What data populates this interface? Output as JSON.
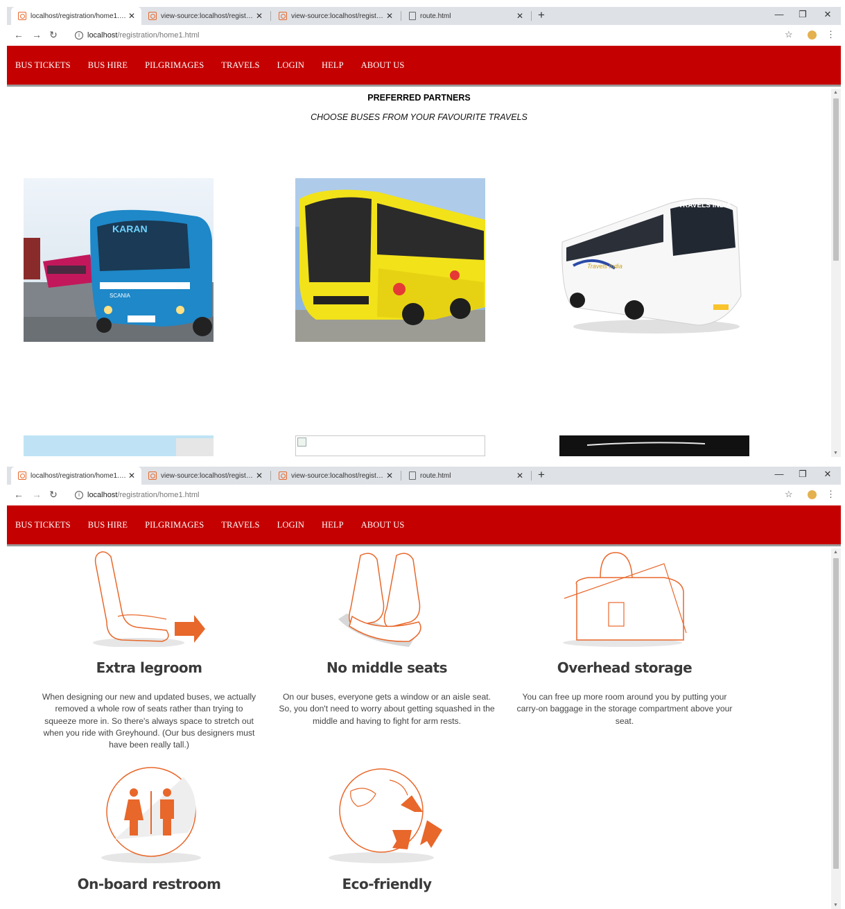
{
  "browser": {
    "tabs": [
      {
        "title": "localhost/registration/home1.htm",
        "icon": "page-icon"
      },
      {
        "title": "view-source:localhost/registration",
        "icon": "page-icon"
      },
      {
        "title": "view-source:localhost/registration",
        "icon": "page-icon"
      },
      {
        "title": "route.html",
        "icon": "document-icon"
      }
    ],
    "url_host": "localhost",
    "url_path": "/registration/home1.html"
  },
  "nav": {
    "items": [
      "BUS TICKETS",
      "BUS HIRE",
      "PILGRIMAGES",
      "TRAVELS",
      "LOGIN",
      "HELP",
      "ABOUT US"
    ],
    "bg_color": "#c50000"
  },
  "partners": {
    "title": "PREFERRED PARTNERS",
    "subtitle": "CHOOSE BUSES FROM YOUR FAVOURITE TRAVELS",
    "bus_labels": [
      "KARAN",
      "SCANIA",
      "TRAVELS INDIA",
      "Travels India"
    ]
  },
  "features": [
    {
      "title": "Extra legroom",
      "text": "When designing our new and updated buses, we actually removed a whole row of seats rather than trying to squeeze more in. So there's always space to stretch out when you ride with Greyhound. (Our bus designers must have been really tall.)"
    },
    {
      "title": "No middle seats",
      "text": "On our buses, everyone gets a window or an aisle seat. So, you don't need to worry about getting squashed in the middle and having to fight for arm rests."
    },
    {
      "title": "Overhead storage",
      "text": "You can free up more room around you by putting your carry-on baggage in the storage compartment above your seat."
    },
    {
      "title": "On-board restroom",
      "text": ""
    },
    {
      "title": "Eco-friendly",
      "text": ""
    }
  ],
  "colors": {
    "accent_orange": "#e8672a"
  }
}
